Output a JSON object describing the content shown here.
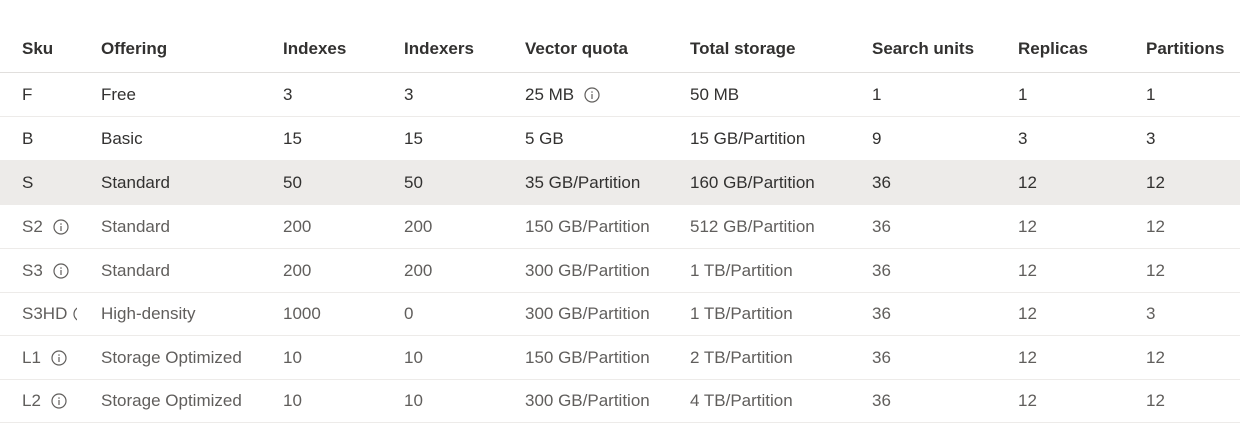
{
  "columns": [
    "Sku",
    "Offering",
    "Indexes",
    "Indexers",
    "Vector quota",
    "Total storage",
    "Search units",
    "Replicas",
    "Partitions"
  ],
  "rows": [
    {
      "sku": "F",
      "offering": "Free",
      "indexes": "3",
      "indexers": "3",
      "vector_quota": "25 MB",
      "total_storage": "50 MB",
      "search_units": "1",
      "replicas": "1",
      "partitions": "1"
    },
    {
      "sku": "B",
      "offering": "Basic",
      "indexes": "15",
      "indexers": "15",
      "vector_quota": "5 GB",
      "total_storage": "15 GB/Partition",
      "search_units": "9",
      "replicas": "3",
      "partitions": "3"
    },
    {
      "sku": "S",
      "offering": "Standard",
      "indexes": "50",
      "indexers": "50",
      "vector_quota": "35 GB/Partition",
      "total_storage": "160 GB/Partition",
      "search_units": "36",
      "replicas": "12",
      "partitions": "12"
    },
    {
      "sku": "S2",
      "offering": "Standard",
      "indexes": "200",
      "indexers": "200",
      "vector_quota": "150 GB/Partition",
      "total_storage": "512 GB/Partition",
      "search_units": "36",
      "replicas": "12",
      "partitions": "12"
    },
    {
      "sku": "S3",
      "offering": "Standard",
      "indexes": "200",
      "indexers": "200",
      "vector_quota": "300 GB/Partition",
      "total_storage": "1 TB/Partition",
      "search_units": "36",
      "replicas": "12",
      "partitions": "12"
    },
    {
      "sku": "S3HD",
      "offering": "High-density",
      "indexes": "1000",
      "indexers": "0",
      "vector_quota": "300 GB/Partition",
      "total_storage": "1 TB/Partition",
      "search_units": "36",
      "replicas": "12",
      "partitions": "3"
    },
    {
      "sku": "L1",
      "offering": "Storage Optimized",
      "indexes": "10",
      "indexers": "10",
      "vector_quota": "150 GB/Partition",
      "total_storage": "2 TB/Partition",
      "search_units": "36",
      "replicas": "12",
      "partitions": "12"
    },
    {
      "sku": "L2",
      "offering": "Storage Optimized",
      "indexes": "10",
      "indexers": "10",
      "vector_quota": "300 GB/Partition",
      "total_storage": "4 TB/Partition",
      "search_units": "36",
      "replicas": "12",
      "partitions": "12"
    }
  ],
  "selected_row_sku": "S",
  "colors": {
    "selected_row_bg": "#edebe9",
    "text_primary": "#323130",
    "text_secondary": "#605e5c",
    "border": "#e1dfdd"
  },
  "icons": {
    "info": "info-icon"
  }
}
